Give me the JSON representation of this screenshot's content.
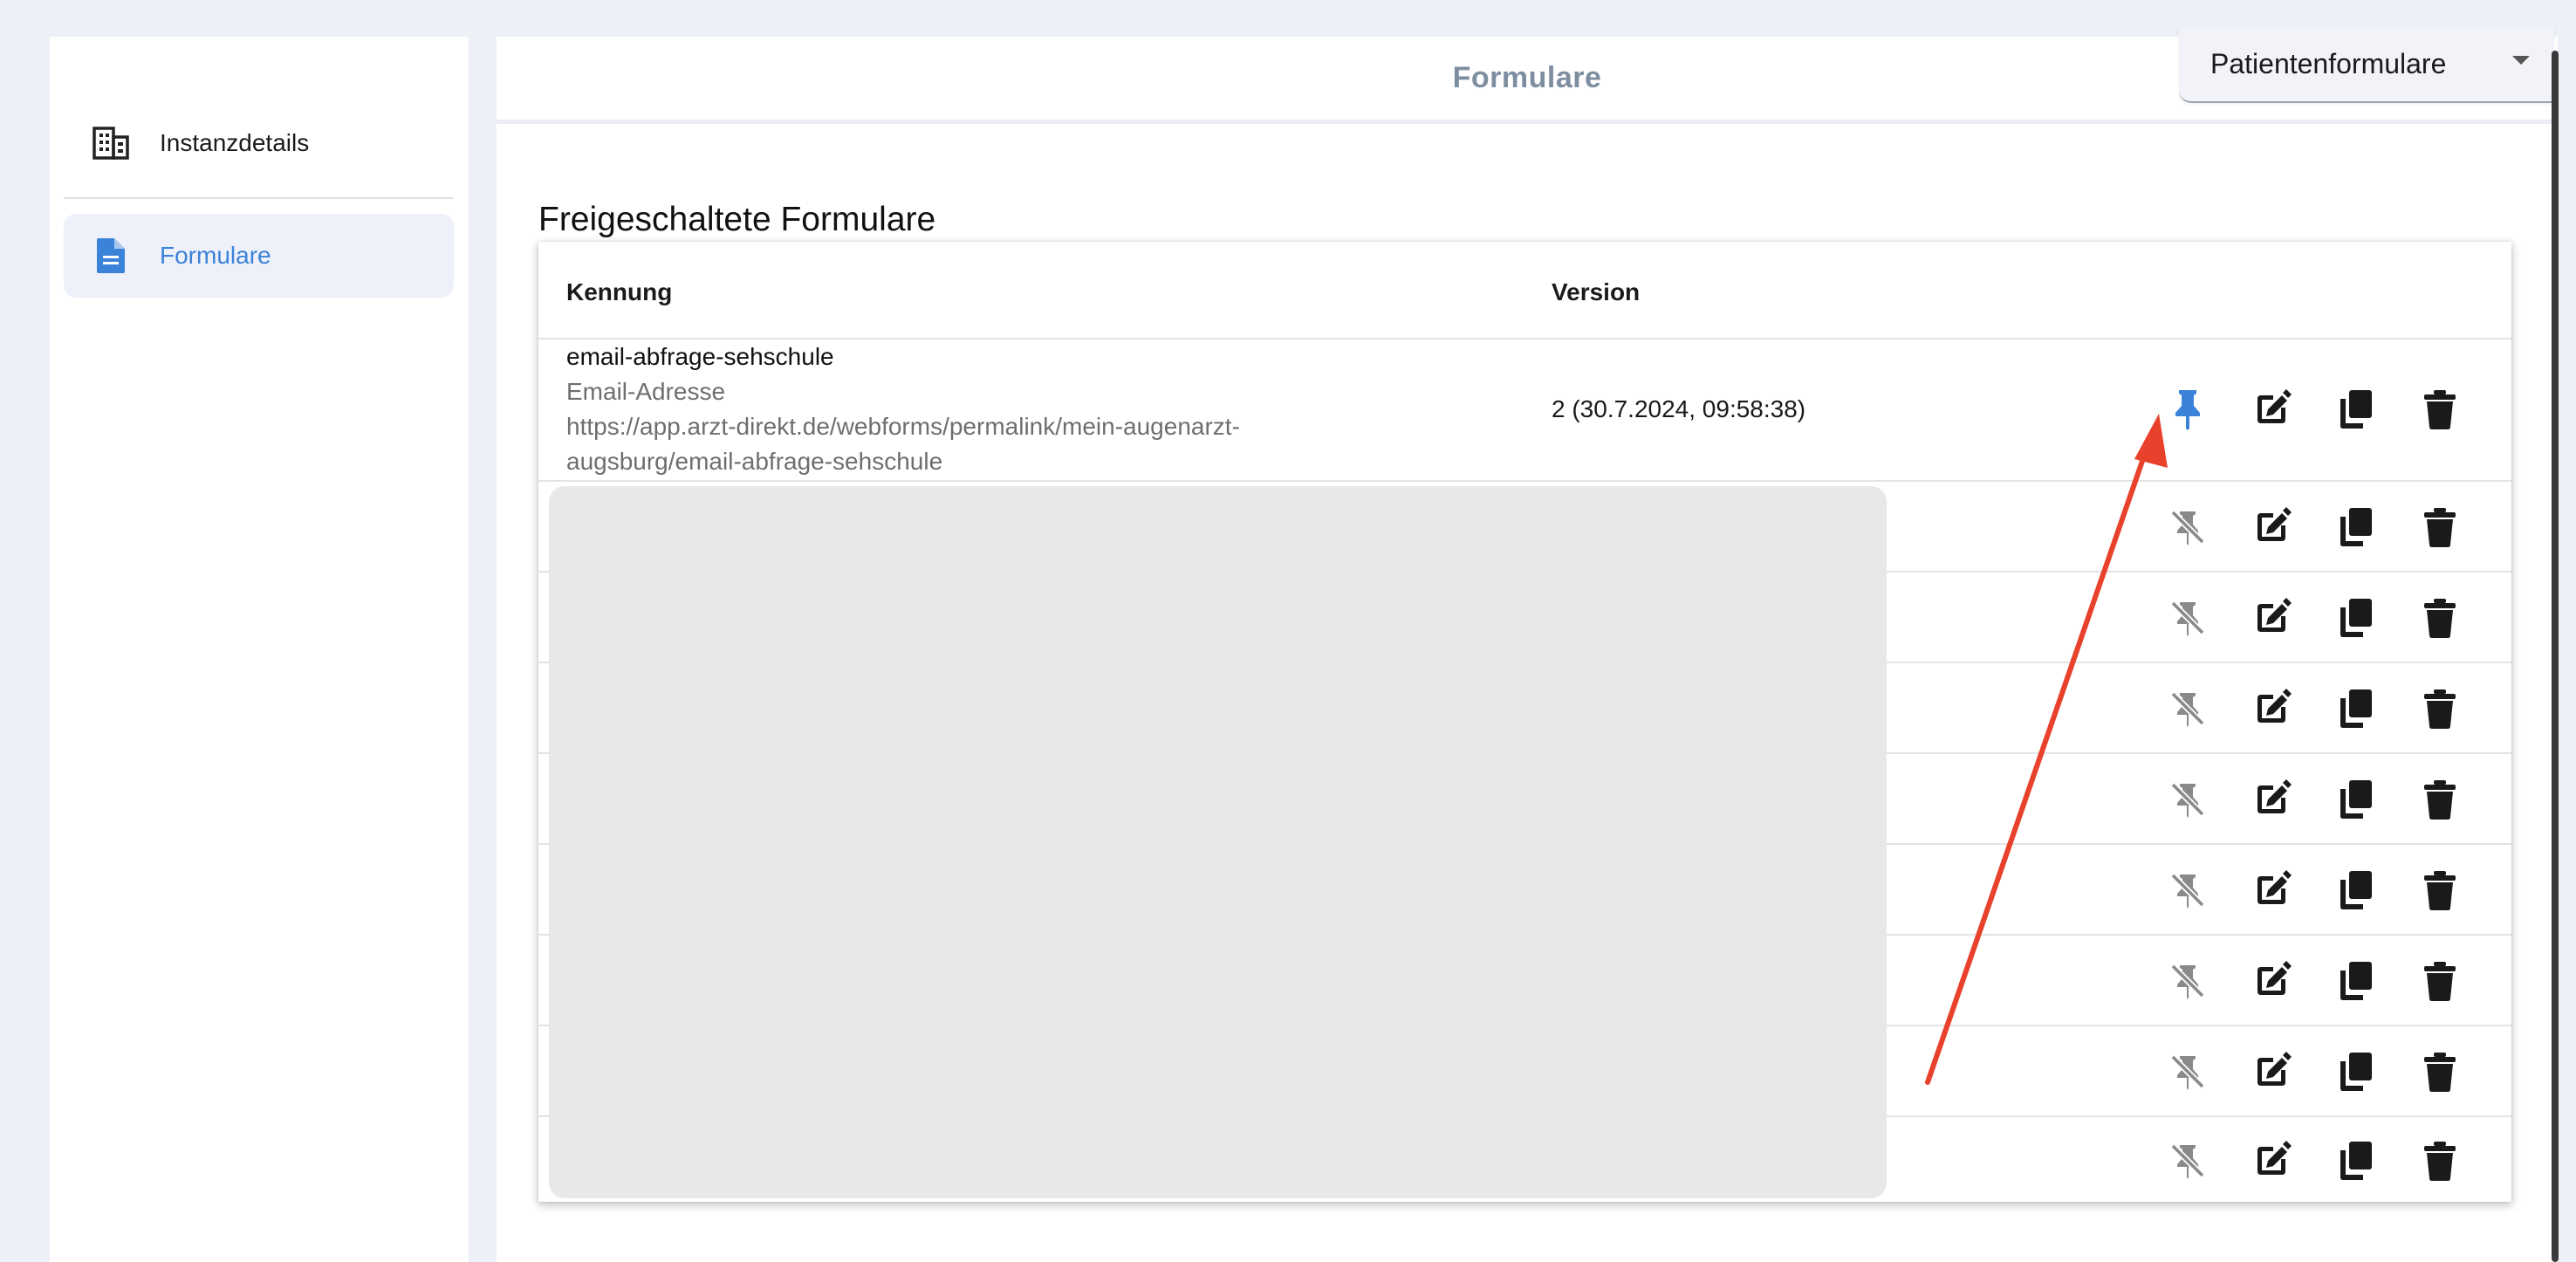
{
  "sidebar": {
    "items": [
      {
        "label": "Instanzdetails",
        "icon": "building-icon",
        "active": false
      },
      {
        "label": "Formulare",
        "icon": "document-icon",
        "active": true
      }
    ]
  },
  "header": {
    "title": "Formulare",
    "form_select": {
      "value": "Patientenformulare",
      "icon": "caret-down-icon"
    }
  },
  "section": {
    "title": "Freigeschaltete Formulare"
  },
  "table": {
    "columns": [
      "Kennung",
      "Version"
    ],
    "rows": [
      {
        "kennung": "email-abfrage-sehschule",
        "subtitle": "Email-Adresse",
        "url_line1": "https://app.arzt-direkt.de/webforms/permalink/mein-augenarzt-",
        "url_line2": "augsburg/email-abfrage-sehschule",
        "version": "2 (30.7.2024, 09:58:38)",
        "pinned": true
      },
      {
        "pinned": false
      },
      {
        "pinned": false
      },
      {
        "pinned": false
      },
      {
        "pinned": false
      },
      {
        "pinned": false
      },
      {
        "pinned": false
      },
      {
        "pinned": false
      },
      {
        "pinned": false
      }
    ]
  },
  "colors": {
    "accent": "#3b82d9",
    "annotation_arrow": "#e8412c",
    "pin_inactive": "#8a8a8a",
    "redaction": "#e8e8e8"
  }
}
